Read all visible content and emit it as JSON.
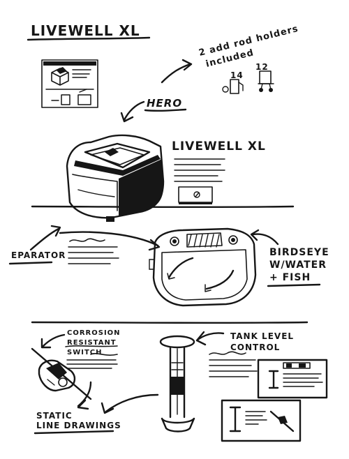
{
  "texts": {
    "title": "LIVEWELL XL",
    "rod_note_1": "2 add rod holders",
    "rod_note_2": "included",
    "rod_num_a": "14",
    "rod_num_b": "12",
    "hero": "HERO",
    "product_name": "LIVEWELL XL",
    "separator": "EPARATOR",
    "birdseye_1": "BIRDSEYE",
    "birdseye_2": "W/WATER",
    "birdseye_3": "+ FISH",
    "corrosion_1": "CORROSION",
    "corrosion_2": "RESISTANT",
    "corrosion_3": "SWITCH",
    "tank_1": "TANK LEVEL",
    "tank_2": "CONTROL",
    "static_1": "STATIC",
    "static_2": "LINE DRAWINGS"
  },
  "colors": {
    "ink": "#161616",
    "paper": "#ffffff"
  }
}
